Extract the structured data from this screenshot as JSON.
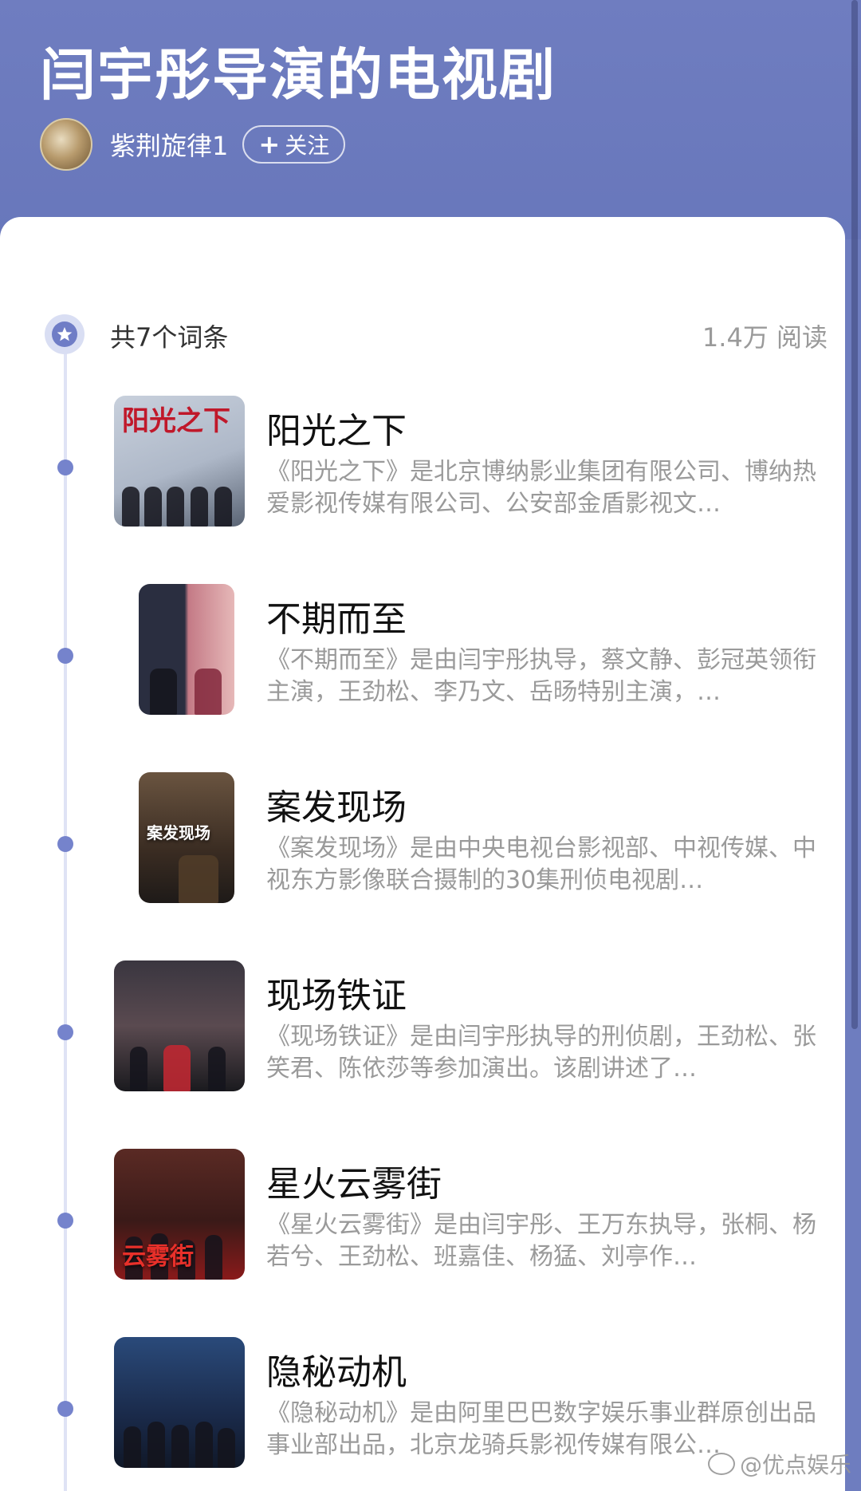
{
  "header": {
    "title": "闫宇彤导演的电视剧",
    "author": "紫荆旋律1",
    "follow_label": "关注",
    "follow_icon": "plus-icon"
  },
  "list": {
    "count_label": "共7个词条",
    "reads_label": "1.4万 阅读",
    "entries": [
      {
        "title": "阳光之下",
        "desc": "《阳光之下》是北京博纳影业集团有限公司、博纳热爱影视传媒有限公司、公安部金盾影视文…",
        "poster_text": "阳光之下",
        "poster_color": "#b8c4d6"
      },
      {
        "title": "不期而至",
        "desc": "《不期而至》是由闫宇彤执导，蔡文静、彭冠英领衔主演，王劲松、李乃文、岳旸特别主演，…",
        "poster_text": "",
        "poster_color": "#3a2a30"
      },
      {
        "title": "案发现场",
        "desc": "《案发现场》是由中央电视台影视部、中视传媒、中视东方影像联合摄制的30集刑侦电视剧…",
        "poster_text": "案发现场",
        "poster_color": "#4a3a2c"
      },
      {
        "title": "现场铁证",
        "desc": "《现场铁证》是由闫宇彤执导的刑侦剧，王劲松、张笑君、陈依莎等参加演出。该剧讲述了…",
        "poster_text": "",
        "poster_color": "#2c2a30"
      },
      {
        "title": "星火云雾街",
        "desc": "《星火云雾街》是由闫宇彤、王万东执导，张桐、杨若兮、王劲松、班嘉佳、杨猛、刘亭作…",
        "poster_text": "云雾街",
        "poster_color": "#4a1e1e"
      },
      {
        "title": "隐秘动机",
        "desc": "《隐秘动机》是由阿里巴巴数字娱乐事业群原创出品事业部出品，北京龙骑兵影视传媒有限公…",
        "poster_text": "",
        "poster_color": "#203050"
      }
    ]
  },
  "watermark": "@优点娱乐",
  "colors": {
    "header_bg": "#6f7dc0",
    "accent": "#7583cc",
    "timeline": "#dfe3f5"
  }
}
